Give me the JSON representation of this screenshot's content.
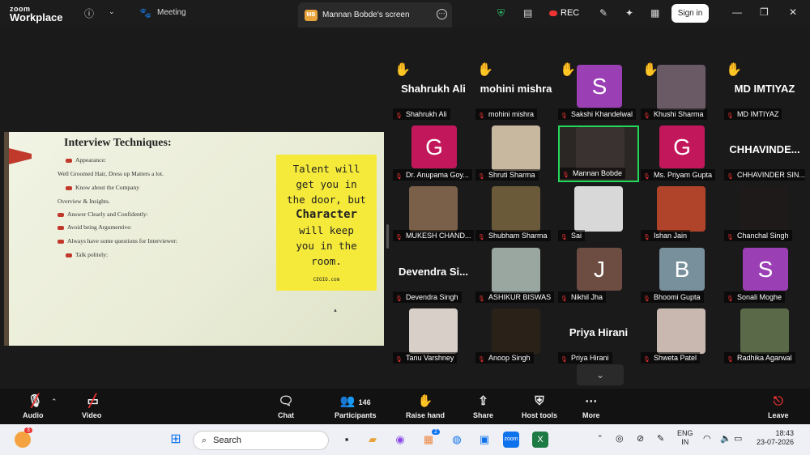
{
  "app": {
    "brand_top": "zoom",
    "brand_bottom": "Workplace",
    "meeting_tab": "Meeting",
    "share_initials": "MB",
    "share_tab": "Mannan Bobde's screen",
    "rec": "REC",
    "signin": "Sign in"
  },
  "slide": {
    "title": "Interview Techniques:",
    "bullets": [
      "Appearance:",
      "Well Groomed Hair, Dress up Matters a lot.",
      "Know about the Company",
      "Overview & Insights.",
      "Answer Clearly and Confidently:",
      "Avoid being Argumentive:",
      "Always have some questions for Interviewer:",
      "Talk politely:"
    ],
    "note_lines": [
      "Talent will",
      "get you in",
      "the door, but",
      "Character",
      "will keep",
      "you in the",
      "room."
    ],
    "note_logo": "CEOIO.com"
  },
  "participants": [
    {
      "name": "Shahrukh Ali",
      "big": "Shahrukh Ali",
      "hand": true
    },
    {
      "name": "mohini mishra",
      "big": "mohini mishra",
      "hand": true
    },
    {
      "name": "Sakshi Khandelwal",
      "initial": "S",
      "color": "#9b3fb5",
      "hand": true
    },
    {
      "name": "Khushi Sharma",
      "photo": "#6a5a66",
      "hand": true
    },
    {
      "name": "MD IMTIYAZ",
      "big": "MD IMTIYAZ",
      "hand": true
    },
    {
      "name": "Dr. Anupama Goy...",
      "initial": "G",
      "color": "#c2185b"
    },
    {
      "name": "Shruti Sharma",
      "photo": "#c9b8a0"
    },
    {
      "name": "Mannan Bobde",
      "photo": "#3a3230",
      "active": true
    },
    {
      "name": "Ms. Priyam Gupta",
      "initial": "G",
      "color": "#c2185b"
    },
    {
      "name": "CHHAVINDER SIN...",
      "big": "CHHAVINDE..."
    },
    {
      "name": "MUKESH CHAND...",
      "photo": "#7a6048"
    },
    {
      "name": "Shubham Sharma",
      "photo": "#6b5a3a"
    },
    {
      "name": "Sai",
      "photo": "#d8d8d8"
    },
    {
      "name": "Ishan Jain",
      "photo": "#b0442a"
    },
    {
      "name": "Chanchal Singh",
      "photo": "#1e1a1a"
    },
    {
      "name": "Devendra Singh",
      "big": "Devendra  Si..."
    },
    {
      "name": "ASHIKUR BISWAS",
      "photo": "#9aa7a0"
    },
    {
      "name": "Nikhil Jha",
      "initial": "J",
      "color": "#6d4c41"
    },
    {
      "name": "Bhoomi Gupta",
      "initial": "B",
      "color": "#78909c"
    },
    {
      "name": "Sonali Moghe",
      "initial": "S",
      "color": "#9b3fb5"
    },
    {
      "name": "Tanu Varshney",
      "photo": "#d8cfc8"
    },
    {
      "name": "Anoop Singh",
      "photo": "#2a2218"
    },
    {
      "name": "Priya Hirani",
      "big": "Priya Hirani"
    },
    {
      "name": "Shweta Patel",
      "photo": "#c8b8b0"
    },
    {
      "name": "Radhika Agarwal",
      "photo": "#5a6a48"
    }
  ],
  "toolbar": {
    "audio": "Audio",
    "video": "Video",
    "chat": "Chat",
    "participants": "Participants",
    "participants_count": "146",
    "raise_hand": "Raise hand",
    "share": "Share",
    "host_tools": "Host tools",
    "more": "More",
    "leave": "Leave"
  },
  "taskbar": {
    "search": "Search",
    "lang1": "ENG",
    "lang2": "IN",
    "time": "18:43",
    "date": "23-07-2026",
    "badge": "3",
    "edge_badge": "2"
  },
  "colors": {
    "accent": "#0e72ed",
    "active_border": "#23d959",
    "rec": "#e33",
    "note": "#f5ea3a"
  }
}
